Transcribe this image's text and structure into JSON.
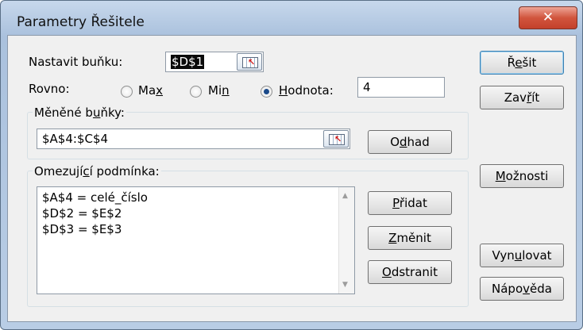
{
  "window": {
    "title": "Parametry Řešitele",
    "close_glyph": "✕"
  },
  "target": {
    "label": "Nastavit buňku:",
    "value": "$D$1"
  },
  "equal_to": {
    "label": "Rovno:",
    "options": [
      {
        "label_before": "Ma",
        "key": "x",
        "label_after": "",
        "selected": false
      },
      {
        "label_before": "Mi",
        "key": "n",
        "label_after": "",
        "selected": false
      },
      {
        "label_before": "",
        "key": "H",
        "label_after": "odnota:",
        "selected": true
      }
    ],
    "value": "4"
  },
  "changing": {
    "label_before": "Měněné b",
    "key": "u",
    "label_after": "ňky:",
    "value": "$A$4:$C$4",
    "guess": {
      "before": "O",
      "key": "d",
      "after": "had"
    }
  },
  "constraints": {
    "label_before": "Omezují",
    "key": "c",
    "label_after": "í podmínka:",
    "items": [
      "$A$4 = celé_číslo",
      "$D$2 = $E$2",
      "$D$3 = $E$3"
    ],
    "add": {
      "before": "",
      "key": "P",
      "after": "řidat"
    },
    "change": {
      "before": "",
      "key": "Z",
      "after": "měnit"
    },
    "delete": {
      "before": "",
      "key": "O",
      "after": "dstranit"
    }
  },
  "buttons": {
    "solve": {
      "before": "Ř",
      "key": "e",
      "after": "šit"
    },
    "close": {
      "before": "Zav",
      "key": "ř",
      "after": "ít"
    },
    "options": {
      "before": "",
      "key": "M",
      "after": "ožnosti"
    },
    "reset": {
      "before": "Vyn",
      "key": "u",
      "after": "lovat"
    },
    "help": {
      "before": "Nápo",
      "key": "v",
      "after": "ěda"
    }
  },
  "icons": {
    "ref_button": "range-select-icon",
    "scroll_up": "scroll-up-arrow-icon",
    "scroll_down": "scroll-down-arrow-icon"
  }
}
